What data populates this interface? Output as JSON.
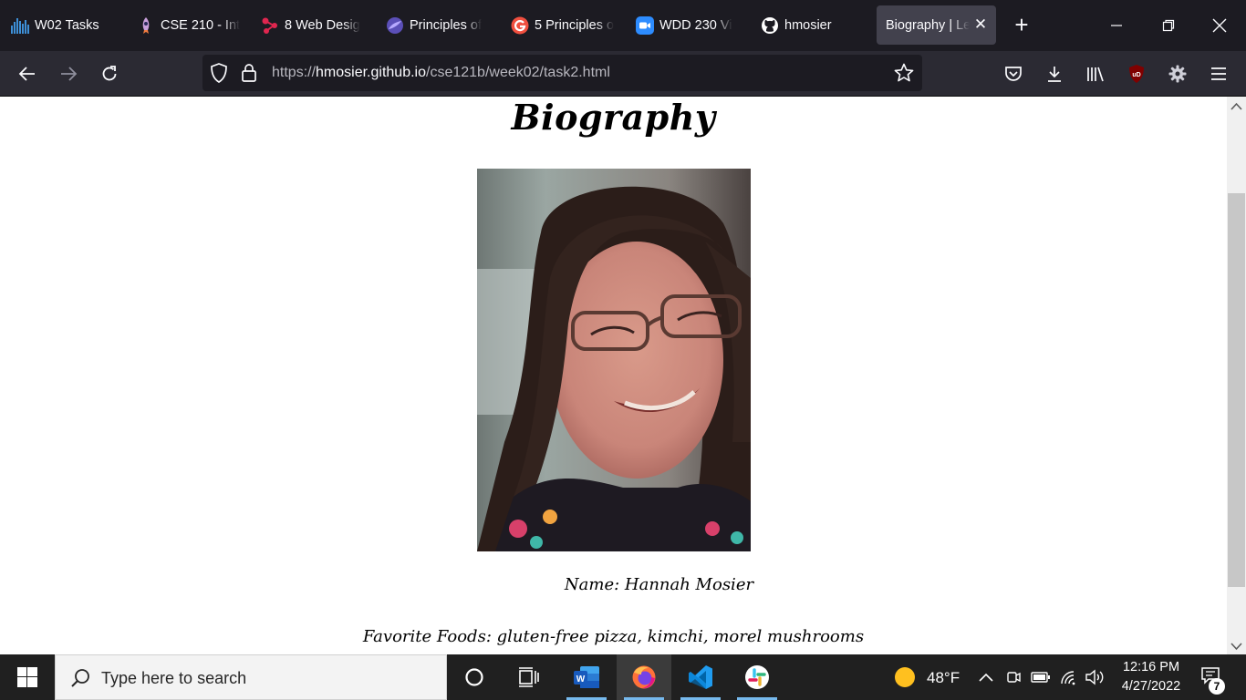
{
  "browser": {
    "tabs": [
      {
        "label": "W02 Tasks",
        "icon": "bar-chart-icon",
        "color": "#3d8fd6"
      },
      {
        "label": "CSE 210 - Int",
        "icon": "rocket-icon",
        "color": "#c9a0dc"
      },
      {
        "label": "8 Web Desig",
        "icon": "share-icon",
        "color": "#e0264f"
      },
      {
        "label": "Principles of",
        "icon": "swirl-icon",
        "color": "#8c7ae6"
      },
      {
        "label": "5 Principles o",
        "icon": "g-icon",
        "color": "#f04f3f"
      },
      {
        "label": "WDD 230 Vi",
        "icon": "zoom-icon",
        "color": "#2d8cff"
      },
      {
        "label": "hmosier",
        "icon": "github-icon",
        "color": "#ffffff"
      },
      {
        "label": "Biography | Le",
        "icon": "none",
        "active": true
      }
    ],
    "url": {
      "scheme": "https://",
      "host": "hmosier.github.io",
      "path": "/cse121b/week02/task2.html"
    }
  },
  "page": {
    "title": "Biography",
    "photo_alt": "portrait photo",
    "name_line": "Name: Hannah Mosier",
    "foods_line": "Favorite Foods: gluten-free pizza, kimchi, morel mushrooms"
  },
  "taskbar": {
    "search_placeholder": "Type here to search",
    "weather_temp": "48°F",
    "time": "12:16 PM",
    "date": "4/27/2022",
    "notification_count": "7",
    "apps": [
      "task-view-icon",
      "word-icon",
      "firefox-icon",
      "vscode-icon",
      "slack-icon"
    ]
  },
  "colors": {
    "tabstrip": "#1c1b22",
    "navbar": "#2b2a33",
    "taskbar": "#202020",
    "accent": "#76b9ed"
  }
}
